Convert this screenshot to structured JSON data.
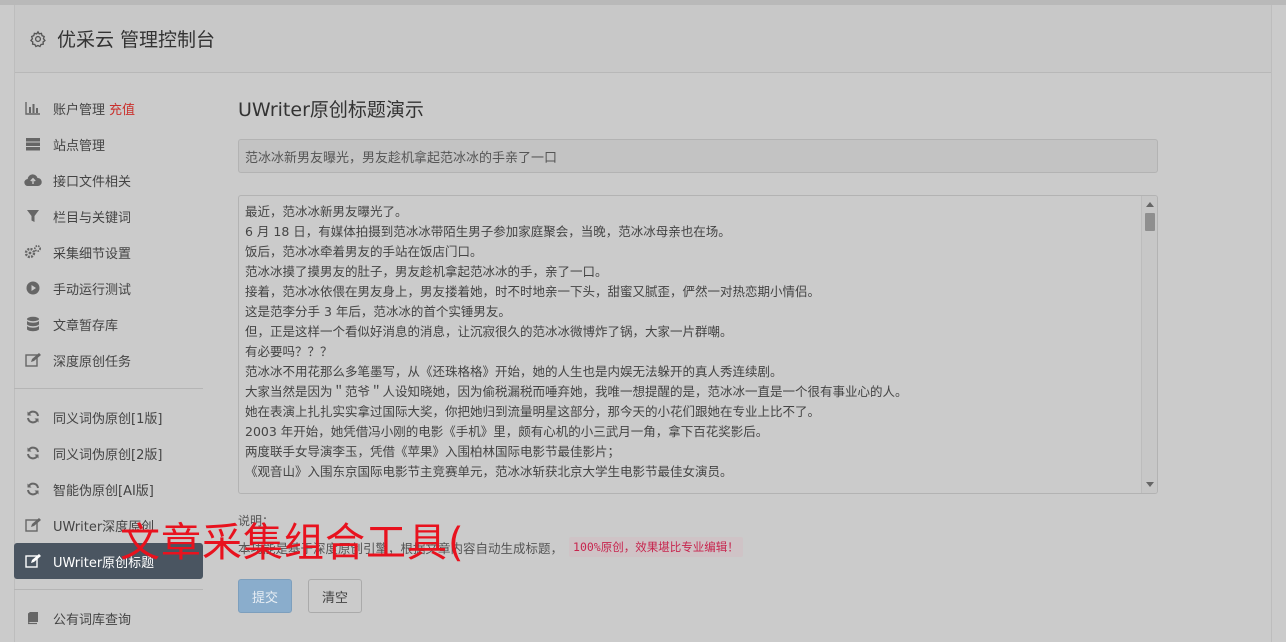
{
  "header": {
    "title": "优采云 管理控制台",
    "icon": "gear-icon"
  },
  "sidebar": {
    "group1": [
      {
        "label": "账户管理",
        "badge": "充值",
        "icon": "bar-chart-icon"
      },
      {
        "label": "站点管理",
        "icon": "server-icon"
      },
      {
        "label": "接口文件相关",
        "icon": "cloud-upload-icon"
      },
      {
        "label": "栏目与关键词",
        "icon": "filter-icon"
      },
      {
        "label": "采集细节设置",
        "icon": "cogs-icon"
      },
      {
        "label": "手动运行测试",
        "icon": "play-circle-icon"
      },
      {
        "label": "文章暂存库",
        "icon": "database-icon"
      },
      {
        "label": "深度原创任务",
        "icon": "edit-icon"
      }
    ],
    "group2": [
      {
        "label": "同义词伪原创[1版]",
        "icon": "refresh-icon"
      },
      {
        "label": "同义词伪原创[2版]",
        "icon": "refresh-icon"
      },
      {
        "label": "智能伪原创[AI版]",
        "icon": "refresh-icon"
      },
      {
        "label": "UWriter深度原创",
        "icon": "edit-icon"
      },
      {
        "label": "UWriter原创标题",
        "icon": "edit-icon",
        "active": true
      }
    ],
    "group3": [
      {
        "label": "公有词库查询",
        "icon": "book-icon"
      }
    ]
  },
  "main": {
    "page_title": "UWriter原创标题演示",
    "title_value": "范冰冰新男友曝光，男友趁机拿起范冰冰的手亲了一口",
    "article_lines": [
      "最近，范冰冰新男友曝光了。",
      "6 月 18 日，有媒体拍摄到范冰冰带陌生男子参加家庭聚会，当晚，范冰冰母亲也在场。",
      "饭后，范冰冰牵着男友的手站在饭店门口。",
      "范冰冰摸了摸男友的肚子，男友趁机拿起范冰冰的手，亲了一口。",
      "接着，范冰冰依偎在男友身上，男友搂着她，时不时地亲一下头，甜蜜又腻歪，俨然一对热恋期小情侣。",
      "这是范李分手 3 年后，范冰冰的首个实锤男友。",
      "但，正是这样一个看似好消息的消息，让沉寂很久的范冰冰微博炸了锅，大家一片群嘲。",
      "有必要吗？？？",
      "范冰冰不用花那么多笔墨写，从《还珠格格》开始，她的人生也是内娱无法躲开的真人秀连续剧。",
      "大家当然是因为＂范爷＂人设知晓她，因为偷税漏税而唾弃她，我唯一想提醒的是，范冰冰一直是一个很有事业心的人。",
      "她在表演上扎扎实实拿过国际大奖，你把她归到流量明星这部分，那今天的小花们跟她在专业上比不了。",
      "2003 年开始，她凭借冯小刚的电影《手机》里，颇有心机的小三武月一角，拿下百花奖影后。",
      "两度联手女导演李玉，凭借《苹果》入围柏林国际电影节最佳影片；",
      "《观音山》入围东京国际电影节主竞赛单元，范冰冰斩获北京大学生电影节最佳女演员。"
    ],
    "note_label": "说明：",
    "note_text": "本功能是基于深度原创引擎，根据文章内容自动生成标题，",
    "note_code": "100%原创，效果堪比专业编辑！",
    "submit_label": "提交",
    "clear_label": "清空"
  },
  "overlay_text": "文章采集组合工具("
}
